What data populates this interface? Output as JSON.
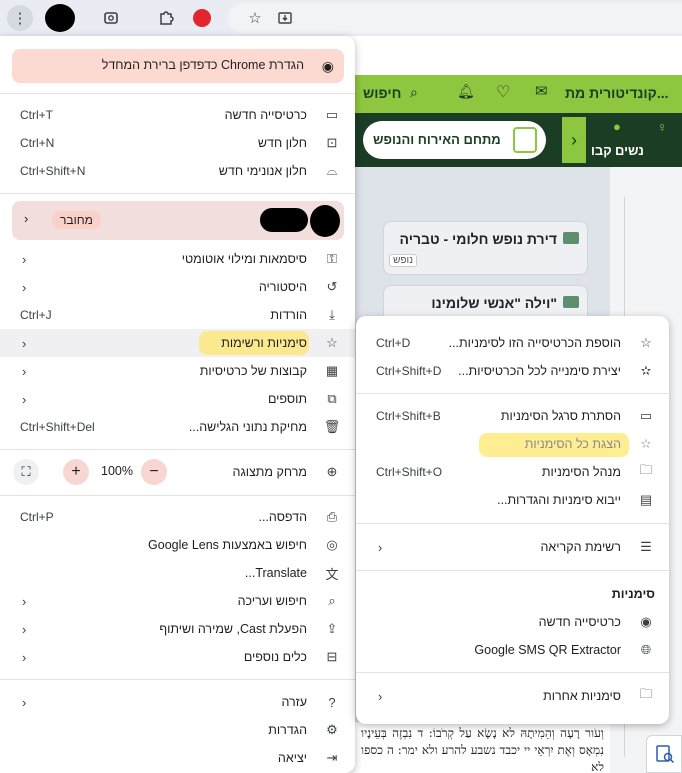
{
  "page": {
    "site_search": "חיפוש",
    "site_title": "קונדיטורית מת...",
    "nav_items": [
      "נשים",
      "קבו"
    ],
    "nav_button": "מתחם האירוח והנופש",
    "listings": [
      {
        "title": "דירת נופש חלומי - טבריה",
        "tag": "נופש"
      },
      {
        "title": "וילה \"אנשי שלומינו\""
      }
    ],
    "scripture": "וְעֹור רָעָה וְהֵמִיתָהּ לא נָשָׂא עַל קְרֹבוֹ: ד נִבְזֶה בְּעֵינָיו נִמְאָס וְאֶת יִרְאֵי יי יכבד נשבע להרע ולא ימר: ה כספו לא"
  },
  "main_menu": {
    "banner": "הגדרת Chrome כדפדפן ברירת המחדל",
    "items_top": [
      {
        "label": "כרטיסייה חדשה",
        "shortcut": "Ctrl+T",
        "icon": "new-tab-icon"
      },
      {
        "label": "חלון חדש",
        "shortcut": "Ctrl+N",
        "icon": "new-window-icon"
      },
      {
        "label": "חלון אנונימי חדש",
        "shortcut": "Ctrl+Shift+N",
        "icon": "incognito-icon"
      }
    ],
    "profile_status": "מחובר",
    "items_mid": [
      {
        "label": "סיסמאות ומילוי אוטומטי",
        "icon": "key-icon"
      },
      {
        "label": "היסטוריה",
        "icon": "history-icon"
      },
      {
        "label": "הורדות",
        "shortcut": "Ctrl+J",
        "icon": "download-icon"
      },
      {
        "label": "סימניות ורשימות",
        "icon": "star-icon"
      },
      {
        "label": "קבוצות של כרטיסיות",
        "icon": "tab-groups-icon"
      },
      {
        "label": "תוספים",
        "icon": "extensions-icon"
      },
      {
        "label": "מחיקת נתוני הגלישה...",
        "shortcut": "Ctrl+Shift+Del",
        "icon": "trash-icon"
      }
    ],
    "zoom": {
      "label": "מרחק מתצוגה",
      "value": "100%",
      "plus": "+",
      "minus": "−"
    },
    "items_bottom": [
      {
        "label": "הדפסה...",
        "shortcut": "Ctrl+P",
        "icon": "print-icon"
      },
      {
        "label": "חיפוש באמצעות Google Lens",
        "icon": "lens-icon"
      },
      {
        "label": "Translate...",
        "icon": "translate-icon"
      },
      {
        "label": "חיפוש ועריכה",
        "icon": "find-icon"
      },
      {
        "label": "הפעלת Cast, שמירה ושיתוף",
        "icon": "cast-icon"
      },
      {
        "label": "כלים נוספים",
        "icon": "toolbox-icon"
      }
    ],
    "items_end": [
      {
        "label": "עזרה",
        "icon": "help-icon"
      },
      {
        "label": "הגדרות",
        "icon": "settings-icon"
      },
      {
        "label": "יציאה",
        "icon": "exit-icon"
      }
    ]
  },
  "sub_menu": {
    "items_a": [
      {
        "label": "הוספת הכרטיסייה הזו לסימניות...",
        "shortcut": "Ctrl+D",
        "icon": "star-outline-icon"
      },
      {
        "label": "יצירת סימנייה לכל הכרטיסיות...",
        "shortcut": "Ctrl+Shift+D",
        "icon": "star-all-icon"
      }
    ],
    "items_b": [
      {
        "label": "הסתרת סרגל הסימניות",
        "shortcut": "Ctrl+Shift+B",
        "icon": "bookmark-bar-icon"
      },
      {
        "label": "הצגת כל הסימניות",
        "icon": "all-bookmarks-icon"
      },
      {
        "label": "מנהל הסימניות",
        "shortcut": "Ctrl+Shift+O",
        "icon": "folder-edit-icon"
      },
      {
        "label": "ייבוא סימניות והגדרות...",
        "icon": "import-icon"
      }
    ],
    "reading_list": "רשימת הקריאה",
    "bookmarks_header": "סימניות",
    "bookmarks": [
      {
        "label": "כרטיסייה חדשה",
        "icon": "chrome-icon"
      },
      {
        "label": "Google SMS QR Extractor",
        "icon": "globe-icon"
      }
    ],
    "other_bookmarks": "סימניות אחרות"
  }
}
